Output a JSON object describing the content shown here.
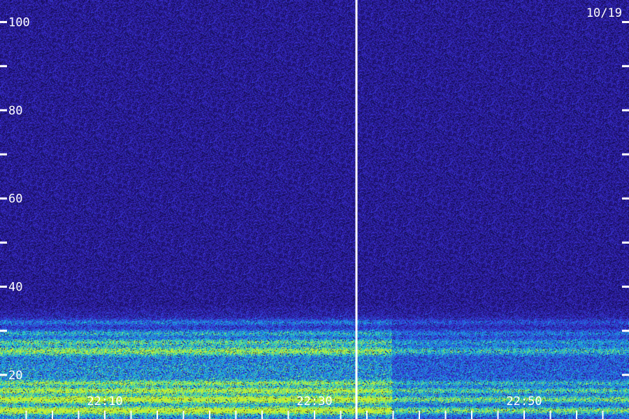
{
  "chart_data": {
    "type": "heatmap",
    "date_label": "10/19",
    "y_axis": {
      "range": [
        10,
        105
      ],
      "labeled_ticks": [
        20,
        40,
        60,
        80,
        100
      ],
      "tick_labels": [
        "20",
        "40",
        "60",
        "80",
        "100"
      ],
      "minor_ticks": [
        30,
        50,
        70,
        90
      ]
    },
    "x_axis": {
      "start": "22:00",
      "end": "23:00",
      "tick_labels": [
        "22:10",
        "22:30",
        "22:50"
      ],
      "minor_tick_minutes": [
        2.5,
        5,
        7.5,
        10,
        12.5,
        15,
        17.5,
        20,
        22.5,
        25,
        27.5,
        30,
        32.5,
        35,
        37.5,
        40,
        42.5,
        45,
        47.5,
        50,
        52.5,
        55,
        57.5
      ]
    },
    "marker_line_time": "22:34",
    "colors": {
      "background": "#1a0f5c",
      "noise_low": "#120a4a",
      "noise_high": "#4a2ad0",
      "mid": "#1f7fe0",
      "high": "#22d8c0",
      "peak": "#c8f030",
      "marker": "#ffffff"
    }
  }
}
